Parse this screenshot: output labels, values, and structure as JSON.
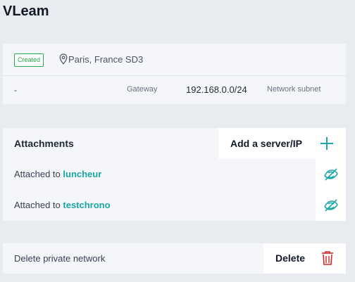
{
  "page": {
    "title": "VLeam"
  },
  "info": {
    "status_badge": "Created",
    "location": "Paris, France SD3",
    "gateway_prefix": "-",
    "gateway_label": "Gateway",
    "subnet_value": "192.168.0.0/24",
    "subnet_label": "Network subnet"
  },
  "attachments": {
    "title": "Attachments",
    "add_button_label": "Add a server/IP",
    "rows": [
      {
        "prefix": "Attached to ",
        "server": "luncheur"
      },
      {
        "prefix": "Attached to ",
        "server": "testchrono"
      }
    ]
  },
  "delete": {
    "text": "Delete private network",
    "button_label": "Delete"
  },
  "colors": {
    "accent": "#1aa6a6",
    "status_green": "#27a64a",
    "danger": "#d62828",
    "background": "#e8ecf0",
    "card": "#f4f6f9"
  },
  "icons": {
    "location": "map-pin-icon",
    "add": "plus-icon",
    "detach": "unlink-icon",
    "delete": "trash-icon"
  }
}
